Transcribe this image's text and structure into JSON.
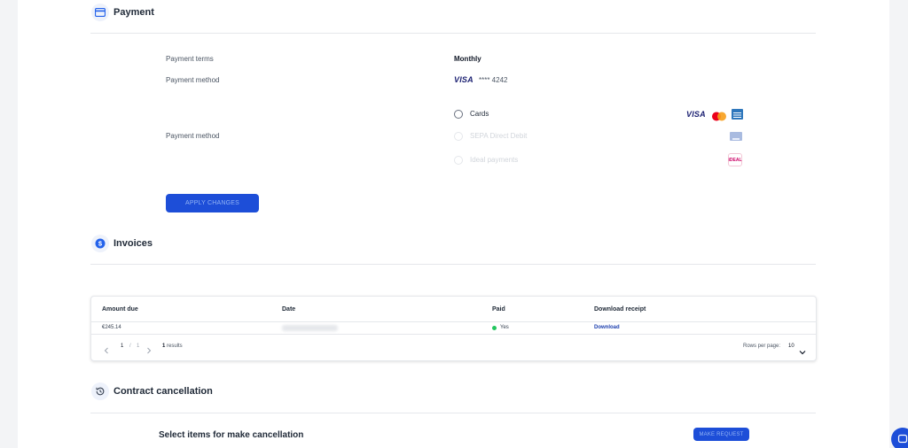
{
  "payment": {
    "title": "Payment",
    "terms_label": "Payment terms",
    "terms_value": "Monthly",
    "method_label": "Payment method",
    "card_brand": "VISA",
    "card_masked": "**** 4242",
    "method_label_2": "Payment method",
    "options": [
      {
        "label": "Cards",
        "enabled": true
      },
      {
        "label": "SEPA Direct Debit",
        "enabled": false
      },
      {
        "label": "Ideal payments",
        "enabled": false
      }
    ],
    "card_logo_visa": "VISA",
    "ideal_logo_text": "iDEAL",
    "apply_label": "APPLY CHANGES"
  },
  "invoices": {
    "title": "Invoices",
    "columns": [
      "Amount due",
      "Date",
      "Paid",
      "Download receipt"
    ],
    "rows": [
      {
        "amount": "€245.14",
        "paid": "Yes",
        "download": "Download"
      }
    ],
    "pagination": {
      "current": "1",
      "separator": "/",
      "total": "1",
      "results_count": "1",
      "results_label": "results"
    },
    "rows_per_page_label": "Rows per page:",
    "rows_per_page_value": "10"
  },
  "cancellation": {
    "title": "Contract cancellation",
    "select_text": "Select items for make cancellation",
    "request_label": "MAKE REQUEST"
  },
  "colors": {
    "accent": "#1d4ed8",
    "status_paid": "#22c55e",
    "link": "#1e40af"
  },
  "icons": [
    "credit-card-icon",
    "dollar-icon",
    "history-icon",
    "chat-icon",
    "chevron-left-icon",
    "chevron-right-icon",
    "chevron-down-icon"
  ]
}
